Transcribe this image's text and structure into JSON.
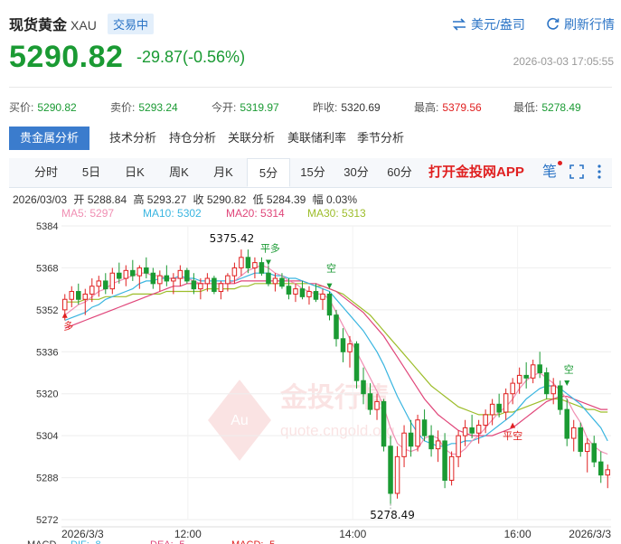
{
  "header": {
    "title": "现货黄金",
    "code": "XAU",
    "status_badge": "交易中",
    "currency_link": "美元/盎司",
    "refresh_link": "刷新行情",
    "price": "5290.82",
    "change": "-29.87(-0.56%)",
    "timestamp": "2026-03-03 17:05:55",
    "price_color": "#1a9a33"
  },
  "stats": [
    {
      "label": "买价:",
      "value": "5290.82",
      "color": "green"
    },
    {
      "label": "卖价:",
      "value": "5293.24",
      "color": "green"
    },
    {
      "label": "今开:",
      "value": "5319.97",
      "color": "green"
    },
    {
      "label": "昨收:",
      "value": "5320.69",
      "color": "neutral"
    },
    {
      "label": "最高:",
      "value": "5379.56",
      "color": "red"
    },
    {
      "label": "最低:",
      "value": "5278.49",
      "color": "green"
    }
  ],
  "analysis_tabs": [
    "贵金属分析",
    "技术分析",
    "持仓分析",
    "关联分析",
    "美联储利率",
    "季节分析"
  ],
  "period_tabs": [
    "分时",
    "5日",
    "日K",
    "周K",
    "月K",
    "5分",
    "15分",
    "30分",
    "60分"
  ],
  "active_period": "5分",
  "app_banner": "打开金投网APP",
  "toolbar_icons": [
    "pen-icon",
    "fullscreen-icon",
    "more-icon"
  ],
  "toolbar_pen_glyph": "笔",
  "bar_info": {
    "date": "2026/03/03",
    "open": "开 5288.84",
    "high": "高 5293.27",
    "close": "收 5290.82",
    "low": "低 5284.39",
    "amplitude": "幅 0.03%"
  },
  "ma_legend": [
    {
      "label": "MA5: 5297",
      "color": "#f08fb3"
    },
    {
      "label": "MA10: 5302",
      "color": "#39b5e0"
    },
    {
      "label": "MA20: 5314",
      "color": "#e0467a"
    },
    {
      "label": "MA30: 5313",
      "color": "#9dbd2a"
    }
  ],
  "macd_legend": [
    "MACD",
    "DIF: -8",
    "DEA: -5",
    "MACD: -5"
  ],
  "watermark": {
    "brand": "金投行情",
    "site": "quote.cngold.org",
    "logo_text": "Au"
  },
  "chart_data": {
    "type": "candlestick",
    "ylim": [
      5272,
      5384
    ],
    "y_ticks": [
      5272,
      5288,
      5304,
      5320,
      5336,
      5352,
      5368,
      5384
    ],
    "x_tick_labels": [
      "2026/3/3",
      "12:00",
      "14:00",
      "16:00",
      "2026/3/3"
    ],
    "annotations": [
      {
        "text": "5375.42",
        "kind": "high"
      },
      {
        "text": "5278.49",
        "kind": "low"
      },
      {
        "text": "多",
        "kind": "signal"
      },
      {
        "text": "平多",
        "kind": "signal"
      },
      {
        "text": "空",
        "kind": "signal"
      },
      {
        "text": "平空",
        "kind": "signal"
      },
      {
        "text": "空",
        "kind": "signal"
      }
    ],
    "up_color": "#e02020",
    "down_color": "#1a9a33",
    "candles": [
      [
        5352,
        5358,
        5348,
        5356
      ],
      [
        5356,
        5361,
        5353,
        5359
      ],
      [
        5359,
        5362,
        5354,
        5356
      ],
      [
        5356,
        5360,
        5350,
        5358
      ],
      [
        5358,
        5364,
        5355,
        5361
      ],
      [
        5361,
        5365,
        5357,
        5363
      ],
      [
        5363,
        5366,
        5358,
        5360
      ],
      [
        5360,
        5368,
        5358,
        5366
      ],
      [
        5366,
        5370,
        5362,
        5364
      ],
      [
        5364,
        5369,
        5361,
        5367
      ],
      [
        5367,
        5371,
        5363,
        5365
      ],
      [
        5365,
        5369,
        5360,
        5368
      ],
      [
        5368,
        5372,
        5364,
        5366
      ],
      [
        5366,
        5368,
        5360,
        5362
      ],
      [
        5362,
        5367,
        5359,
        5365
      ],
      [
        5365,
        5369,
        5361,
        5363
      ],
      [
        5363,
        5366,
        5358,
        5364
      ],
      [
        5364,
        5369,
        5361,
        5367
      ],
      [
        5367,
        5368,
        5362,
        5363
      ],
      [
        5363,
        5366,
        5358,
        5360
      ],
      [
        5360,
        5364,
        5356,
        5362
      ],
      [
        5362,
        5366,
        5359,
        5364
      ],
      [
        5364,
        5365,
        5358,
        5359
      ],
      [
        5359,
        5363,
        5356,
        5362
      ],
      [
        5362,
        5366,
        5359,
        5365
      ],
      [
        5365,
        5370,
        5362,
        5368
      ],
      [
        5368,
        5375,
        5365,
        5372
      ],
      [
        5372,
        5375,
        5366,
        5368
      ],
      [
        5368,
        5372,
        5364,
        5370
      ],
      [
        5370,
        5372,
        5365,
        5366
      ],
      [
        5366,
        5369,
        5361,
        5362
      ],
      [
        5362,
        5366,
        5359,
        5364
      ],
      [
        5364,
        5366,
        5360,
        5361
      ],
      [
        5361,
        5364,
        5356,
        5358
      ],
      [
        5358,
        5362,
        5355,
        5360
      ],
      [
        5360,
        5363,
        5356,
        5357
      ],
      [
        5357,
        5361,
        5354,
        5359
      ],
      [
        5359,
        5362,
        5355,
        5356
      ],
      [
        5356,
        5360,
        5352,
        5358
      ],
      [
        5358,
        5359,
        5348,
        5350
      ],
      [
        5350,
        5352,
        5338,
        5341
      ],
      [
        5341,
        5345,
        5332,
        5336
      ],
      [
        5336,
        5342,
        5330,
        5339
      ],
      [
        5339,
        5340,
        5322,
        5325
      ],
      [
        5325,
        5330,
        5316,
        5320
      ],
      [
        5320,
        5324,
        5312,
        5314
      ],
      [
        5314,
        5320,
        5310,
        5317
      ],
      [
        5317,
        5318,
        5298,
        5300
      ],
      [
        5300,
        5304,
        5278,
        5282
      ],
      [
        5282,
        5300,
        5280,
        5296
      ],
      [
        5296,
        5308,
        5292,
        5305
      ],
      [
        5305,
        5310,
        5296,
        5300
      ],
      [
        5300,
        5312,
        5298,
        5310
      ],
      [
        5310,
        5314,
        5302,
        5304
      ],
      [
        5304,
        5308,
        5296,
        5299
      ],
      [
        5299,
        5306,
        5294,
        5302
      ],
      [
        5302,
        5305,
        5284,
        5287
      ],
      [
        5287,
        5298,
        5285,
        5296
      ],
      [
        5296,
        5306,
        5292,
        5304
      ],
      [
        5304,
        5310,
        5300,
        5307
      ],
      [
        5307,
        5312,
        5303,
        5305
      ],
      [
        5305,
        5310,
        5301,
        5308
      ],
      [
        5308,
        5314,
        5305,
        5312
      ],
      [
        5312,
        5318,
        5308,
        5316
      ],
      [
        5316,
        5320,
        5311,
        5313
      ],
      [
        5313,
        5322,
        5310,
        5320
      ],
      [
        5320,
        5326,
        5316,
        5324
      ],
      [
        5324,
        5330,
        5320,
        5327
      ],
      [
        5327,
        5332,
        5322,
        5326
      ],
      [
        5326,
        5333,
        5324,
        5331
      ],
      [
        5331,
        5336,
        5326,
        5328
      ],
      [
        5328,
        5330,
        5318,
        5320
      ],
      [
        5320,
        5326,
        5316,
        5323
      ],
      [
        5323,
        5325,
        5312,
        5314
      ],
      [
        5314,
        5318,
        5300,
        5303
      ],
      [
        5303,
        5310,
        5298,
        5307
      ],
      [
        5307,
        5309,
        5296,
        5298
      ],
      [
        5298,
        5303,
        5290,
        5301
      ],
      [
        5301,
        5304,
        5292,
        5294
      ],
      [
        5294,
        5298,
        5286,
        5289
      ],
      [
        5289,
        5293,
        5284,
        5291
      ]
    ],
    "ma5": [
      5350,
      5352,
      5354,
      5355,
      5357,
      5359,
      5360,
      5362,
      5363,
      5364,
      5365,
      5366,
      5366,
      5365,
      5365,
      5364,
      5364,
      5364,
      5364,
      5363,
      5362,
      5362,
      5362,
      5362,
      5362,
      5363,
      5365,
      5367,
      5368,
      5369,
      5368,
      5366,
      5365,
      5363,
      5362,
      5360,
      5359,
      5358,
      5358,
      5356,
      5351,
      5346,
      5341,
      5336,
      5331,
      5326,
      5321,
      5315,
      5307,
      5301,
      5299,
      5298,
      5299,
      5303,
      5304,
      5303,
      5299,
      5297,
      5297,
      5299,
      5302,
      5304,
      5307,
      5310,
      5313,
      5315,
      5318,
      5322,
      5325,
      5327,
      5328,
      5326,
      5324,
      5321,
      5318,
      5313,
      5309,
      5303,
      5300,
      5298,
      5297
    ],
    "ma10": [
      5348,
      5349,
      5350,
      5351,
      5353,
      5354,
      5356,
      5357,
      5358,
      5359,
      5360,
      5362,
      5363,
      5363,
      5364,
      5364,
      5364,
      5365,
      5364,
      5364,
      5363,
      5363,
      5363,
      5363,
      5363,
      5363,
      5364,
      5365,
      5366,
      5366,
      5366,
      5365,
      5365,
      5364,
      5364,
      5363,
      5362,
      5361,
      5360,
      5359,
      5356,
      5353,
      5350,
      5347,
      5344,
      5340,
      5336,
      5331,
      5325,
      5319,
      5314,
      5309,
      5305,
      5302,
      5301,
      5300,
      5300,
      5301,
      5301,
      5302,
      5302,
      5303,
      5304,
      5306,
      5308,
      5310,
      5312,
      5315,
      5318,
      5320,
      5322,
      5323,
      5323,
      5322,
      5320,
      5318,
      5316,
      5313,
      5310,
      5307,
      5302
    ],
    "ma20": [
      5345,
      5346,
      5347,
      5348,
      5349,
      5350,
      5351,
      5352,
      5353,
      5354,
      5355,
      5356,
      5357,
      5358,
      5359,
      5360,
      5361,
      5361,
      5362,
      5362,
      5362,
      5362,
      5362,
      5362,
      5362,
      5362,
      5363,
      5363,
      5363,
      5363,
      5363,
      5363,
      5363,
      5363,
      5363,
      5363,
      5362,
      5362,
      5361,
      5360,
      5359,
      5357,
      5355,
      5353,
      5351,
      5348,
      5345,
      5342,
      5338,
      5334,
      5330,
      5326,
      5322,
      5318,
      5315,
      5312,
      5310,
      5308,
      5306,
      5305,
      5304,
      5304,
      5304,
      5304,
      5305,
      5306,
      5307,
      5309,
      5311,
      5313,
      5315,
      5317,
      5318,
      5319,
      5319,
      5318,
      5317,
      5316,
      5315,
      5314,
      5314
    ],
    "ma30": [
      5355,
      5355,
      5355,
      5356,
      5356,
      5356,
      5357,
      5357,
      5357,
      5357,
      5358,
      5358,
      5358,
      5358,
      5358,
      5359,
      5359,
      5359,
      5359,
      5359,
      5359,
      5360,
      5360,
      5360,
      5360,
      5360,
      5361,
      5361,
      5362,
      5362,
      5362,
      5362,
      5362,
      5362,
      5362,
      5362,
      5362,
      5361,
      5361,
      5360,
      5359,
      5358,
      5356,
      5354,
      5352,
      5350,
      5347,
      5344,
      5341,
      5338,
      5335,
      5332,
      5329,
      5326,
      5323,
      5321,
      5319,
      5317,
      5315,
      5314,
      5313,
      5312,
      5312,
      5312,
      5312,
      5313,
      5313,
      5314,
      5315,
      5316,
      5317,
      5318,
      5318,
      5318,
      5317,
      5316,
      5315,
      5314,
      5314,
      5313,
      5313
    ]
  }
}
